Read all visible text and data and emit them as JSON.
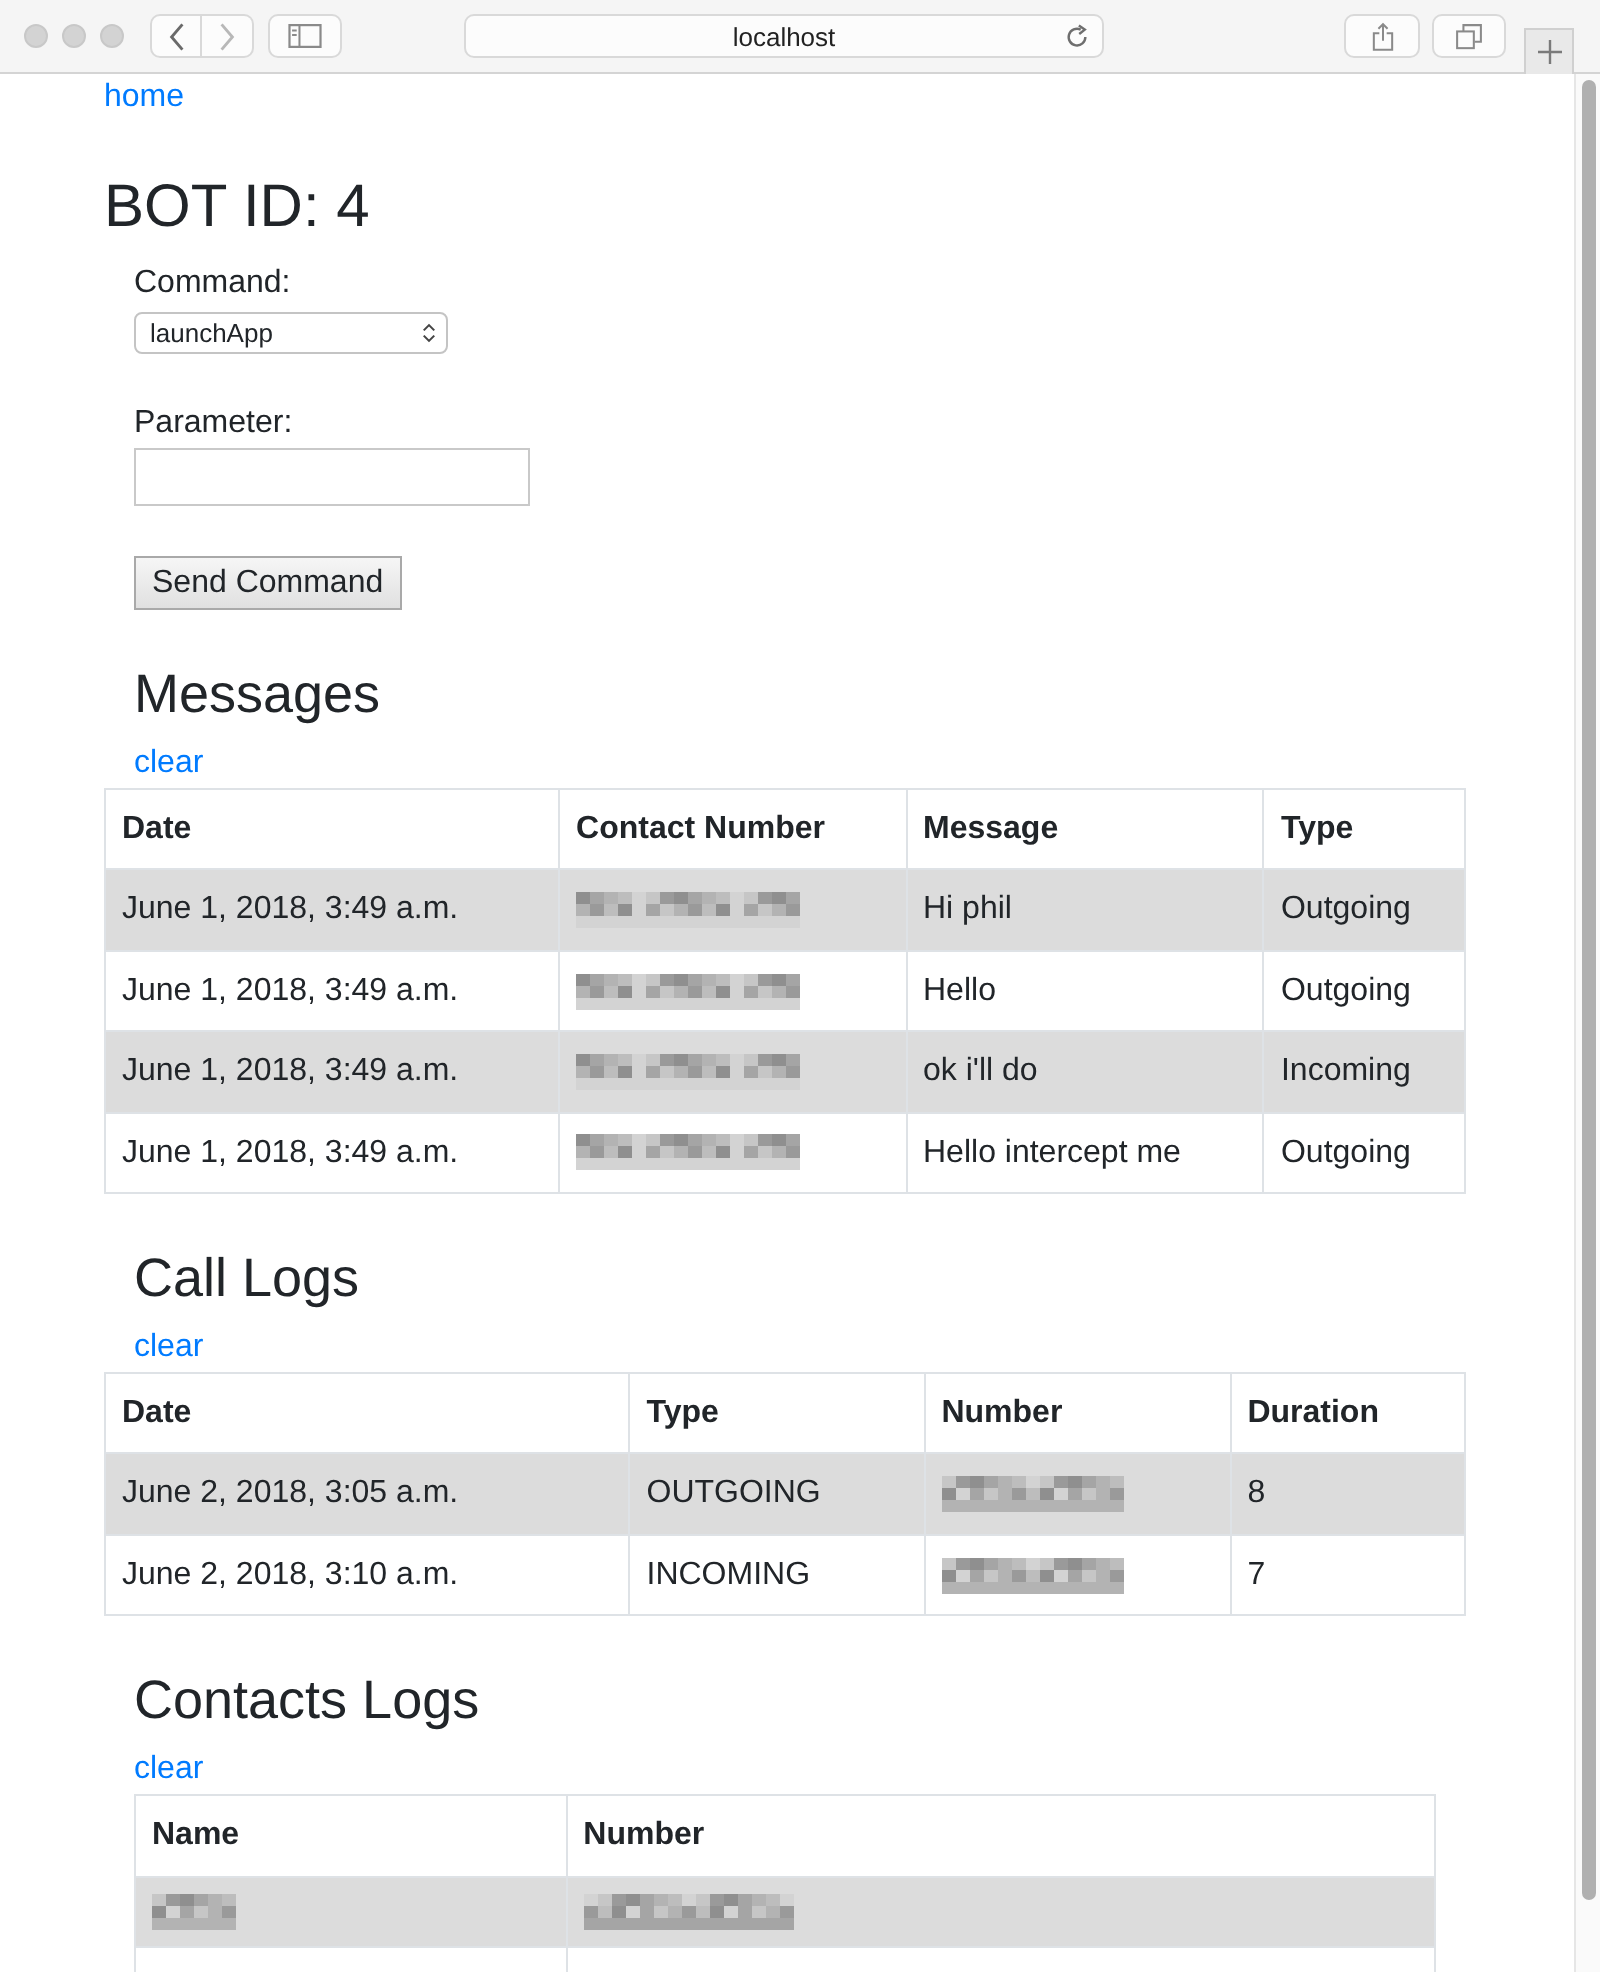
{
  "browser": {
    "address": "localhost",
    "back_disabled": false,
    "forward_disabled": true
  },
  "page": {
    "home_link": "home",
    "title": "BOT ID: 4",
    "form": {
      "command_label": "Command:",
      "command_value": "launchApp",
      "parameter_label": "Parameter:",
      "submit": "Send Command"
    },
    "sections": [
      {
        "heading": "Messages",
        "clear_link": "clear",
        "table": {
          "columns": [
            "Date",
            "Contact Number",
            "Message",
            "Type"
          ],
          "rows": [
            {
              "cells": [
                {
                  "text": "June 1, 2018, 3:49 a.m."
                },
                {
                  "redacted": true
                },
                {
                  "text": "Hi phil"
                },
                {
                  "text": "Outgoing"
                }
              ]
            },
            {
              "cells": [
                {
                  "text": "June 1, 2018, 3:49 a.m."
                },
                {
                  "redacted": true
                },
                {
                  "text": "Hello"
                },
                {
                  "text": "Outgoing"
                }
              ]
            },
            {
              "cells": [
                {
                  "text": "June 1, 2018, 3:49 a.m."
                },
                {
                  "redacted": true
                },
                {
                  "text": "ok i'll do"
                },
                {
                  "text": "Incoming"
                }
              ]
            },
            {
              "cells": [
                {
                  "text": "June 1, 2018, 3:49 a.m."
                },
                {
                  "redacted": true
                },
                {
                  "text": "Hello intercept me"
                },
                {
                  "text": "Outgoing"
                }
              ]
            }
          ]
        }
      },
      {
        "heading": "Call Logs",
        "clear_link": "clear",
        "table": {
          "columns": [
            "Date",
            "Type",
            "Number",
            "Duration"
          ],
          "rows": [
            {
              "cells": [
                {
                  "text": "June 2, 2018, 3:05 a.m."
                },
                {
                  "text": "OUTGOING"
                },
                {
                  "redacted": true
                },
                {
                  "text": "8"
                }
              ]
            },
            {
              "cells": [
                {
                  "text": "June 2, 2018, 3:10 a.m."
                },
                {
                  "text": "INCOMING"
                },
                {
                  "redacted": true
                },
                {
                  "text": "7"
                }
              ]
            }
          ]
        }
      },
      {
        "heading": "Contacts Logs",
        "clear_link": "clear",
        "table": {
          "columns": [
            "Name",
            "Number"
          ],
          "rows": [
            {
              "cells": [
                {
                  "redacted": true
                },
                {
                  "redacted": true
                }
              ]
            },
            {
              "cells": [
                {
                  "redacted": false
                },
                {
                  "redacted": false
                }
              ]
            }
          ]
        }
      }
    ]
  }
}
